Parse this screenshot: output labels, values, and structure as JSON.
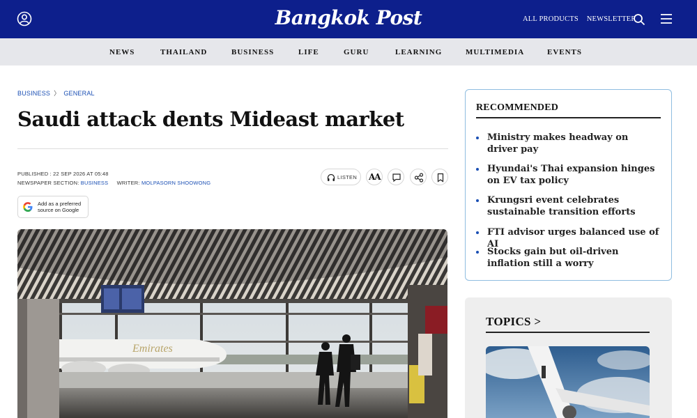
{
  "header": {
    "logo": "Bangkok Post",
    "links": [
      "ALL PRODUCTS",
      "NEWSLETTER"
    ],
    "icons": [
      "user-icon",
      "search-icon",
      "menu-icon"
    ]
  },
  "nav": {
    "items": [
      "NEWS",
      "THAILAND",
      "BUSINESS",
      "LIFE",
      "GURU",
      "LEARNING",
      "MULTIMEDIA",
      "EVENTS"
    ]
  },
  "article": {
    "breadcrumb": [
      "BUSINESS",
      "GENERAL"
    ],
    "headline": "Saudi attack dents Mideast market",
    "published_label": "PUBLISHED : 22 SEP 2026 AT 05:48",
    "section_label": "NEWSPAPER SECTION:",
    "section_value": "BUSINESS",
    "writer_label": "WRITER:",
    "writer_value": "MOLPASORN SHOOWONG",
    "listen_label": "LISTEN",
    "font_size_label": "AA",
    "google_badge_line1": "Add as a preferred",
    "google_badge_line2": "source on Google"
  },
  "recommended": {
    "title": "RECOMMENDED",
    "items": [
      "Ministry makes headway on driver pay",
      "Hyundai's Thai expansion hinges on EV tax policy",
      "Krungsri event celebrates sustainable transition efforts",
      "FTI advisor urges balanced use of AI",
      "Stocks gain but oil-driven inflation still a worry"
    ]
  },
  "topics": {
    "title": "TOPICS",
    "chevron": ">"
  },
  "colors": {
    "header_bg": "#0d1f8c",
    "nav_bg": "#e6e7eb",
    "link_blue": "#1a4fb4",
    "card_border": "#8fbde0"
  }
}
